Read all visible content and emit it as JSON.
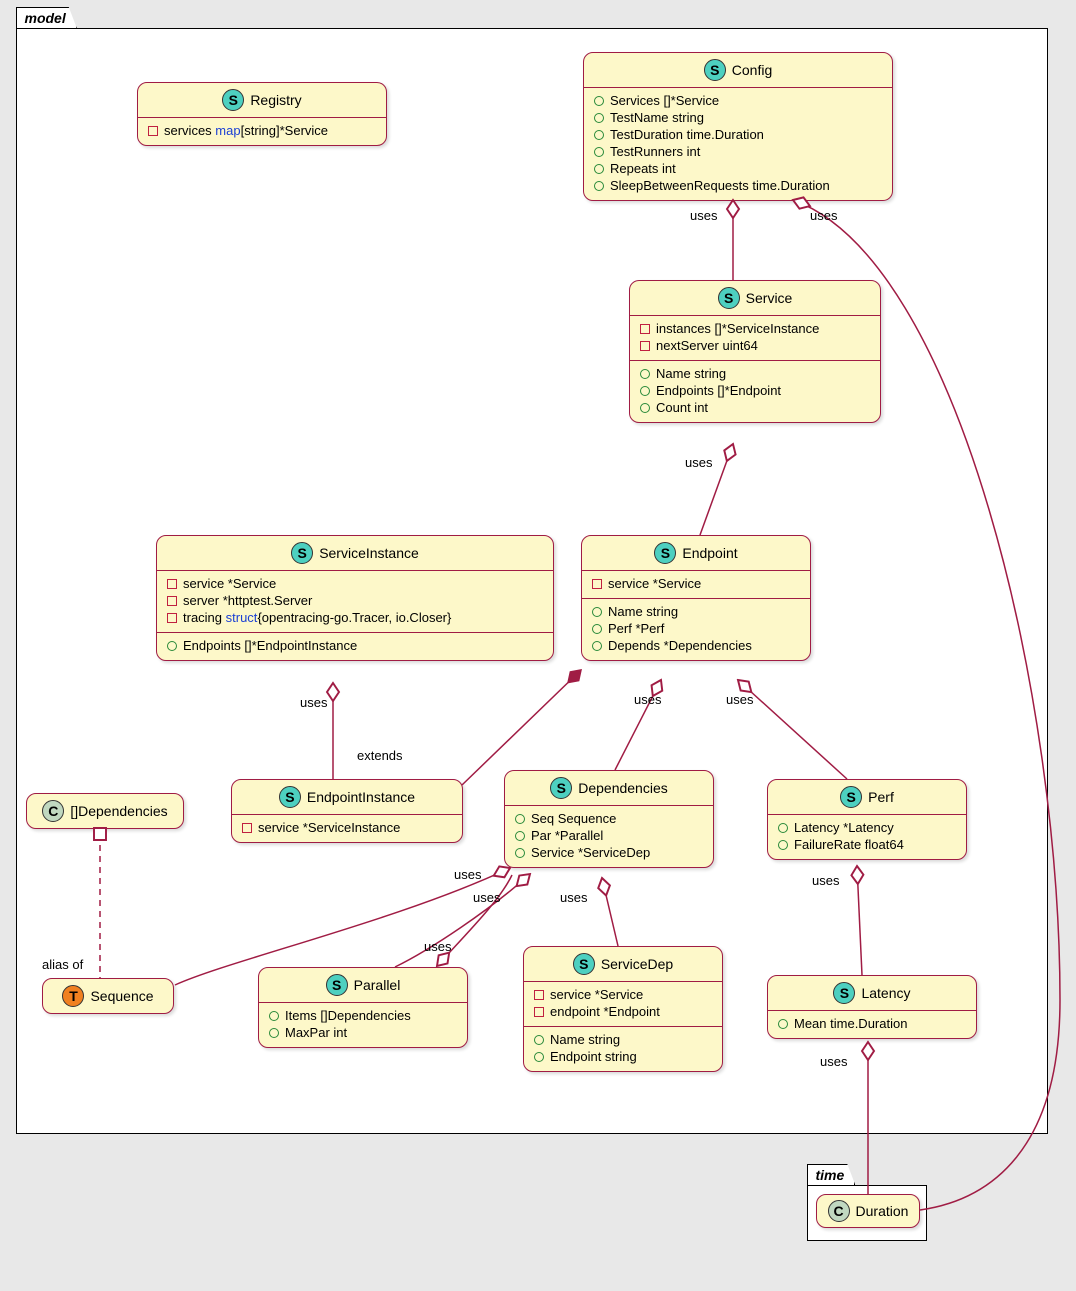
{
  "packages": {
    "model": "model",
    "time": "time"
  },
  "classes": {
    "Registry": {
      "name": "Registry",
      "icon": "S",
      "attrs": [
        {
          "vis": "priv",
          "text": "services ",
          "kw": "map",
          "rest": "[string]*Service"
        }
      ]
    },
    "Config": {
      "name": "Config",
      "icon": "S",
      "attrs": [
        {
          "vis": "pub",
          "text": "Services []*Service"
        },
        {
          "vis": "pub",
          "text": "TestName string"
        },
        {
          "vis": "pub",
          "text": "TestDuration time.Duration"
        },
        {
          "vis": "pub",
          "text": "TestRunners int"
        },
        {
          "vis": "pub",
          "text": "Repeats int"
        },
        {
          "vis": "pub",
          "text": "SleepBetweenRequests time.Duration"
        }
      ]
    },
    "Service": {
      "name": "Service",
      "icon": "S",
      "sectionA": [
        {
          "vis": "priv",
          "text": "instances []*ServiceInstance"
        },
        {
          "vis": "priv",
          "text": "nextServer uint64"
        }
      ],
      "sectionB": [
        {
          "vis": "pub",
          "text": "Name string"
        },
        {
          "vis": "pub",
          "text": "Endpoints []*Endpoint"
        },
        {
          "vis": "pub",
          "text": "Count int"
        }
      ]
    },
    "ServiceInstance": {
      "name": "ServiceInstance",
      "icon": "S",
      "sectionA": [
        {
          "vis": "priv",
          "text": "service *Service"
        },
        {
          "vis": "priv",
          "text": "server *httptest.Server"
        },
        {
          "vis": "priv",
          "text": "tracing ",
          "kw": "struct",
          "rest": "{opentracing-go.Tracer, io.Closer}"
        }
      ],
      "sectionB": [
        {
          "vis": "pub",
          "text": "Endpoints []*EndpointInstance"
        }
      ]
    },
    "Endpoint": {
      "name": "Endpoint",
      "icon": "S",
      "sectionA": [
        {
          "vis": "priv",
          "text": "service *Service"
        }
      ],
      "sectionB": [
        {
          "vis": "pub",
          "text": "Name string"
        },
        {
          "vis": "pub",
          "text": "Perf *Perf"
        },
        {
          "vis": "pub",
          "text": "Depends *Dependencies"
        }
      ]
    },
    "DependenciesC": {
      "name": "[]Dependencies",
      "icon": "C"
    },
    "EndpointInstance": {
      "name": "EndpointInstance",
      "icon": "S",
      "attrs": [
        {
          "vis": "priv",
          "text": "service *ServiceInstance"
        }
      ]
    },
    "Dependencies": {
      "name": "Dependencies",
      "icon": "S",
      "attrs": [
        {
          "vis": "pub",
          "text": "Seq Sequence"
        },
        {
          "vis": "pub",
          "text": "Par *Parallel"
        },
        {
          "vis": "pub",
          "text": "Service *ServiceDep"
        }
      ]
    },
    "Perf": {
      "name": "Perf",
      "icon": "S",
      "attrs": [
        {
          "vis": "pub",
          "text": "Latency *Latency"
        },
        {
          "vis": "pub",
          "text": "FailureRate float64"
        }
      ]
    },
    "Sequence": {
      "name": "Sequence",
      "icon": "T"
    },
    "Parallel": {
      "name": "Parallel",
      "icon": "S",
      "attrs": [
        {
          "vis": "pub",
          "text": "Items []Dependencies"
        },
        {
          "vis": "pub",
          "text": "MaxPar int"
        }
      ]
    },
    "ServiceDep": {
      "name": "ServiceDep",
      "icon": "S",
      "sectionA": [
        {
          "vis": "priv",
          "text": "service *Service"
        },
        {
          "vis": "priv",
          "text": "endpoint *Endpoint"
        }
      ],
      "sectionB": [
        {
          "vis": "pub",
          "text": "Name string"
        },
        {
          "vis": "pub",
          "text": "Endpoint string"
        }
      ]
    },
    "Latency": {
      "name": "Latency",
      "icon": "S",
      "attrs": [
        {
          "vis": "pub",
          "text": "Mean time.Duration"
        }
      ]
    },
    "Duration": {
      "name": "Duration",
      "icon": "C"
    }
  },
  "edgeLabels": {
    "uses1": "uses",
    "uses2": "uses",
    "uses3": "uses",
    "uses4": "uses",
    "uses5": "uses",
    "uses6": "uses",
    "uses7": "uses",
    "uses8": "uses",
    "uses9": "uses",
    "uses10": "uses",
    "uses11": "uses",
    "extends": "extends",
    "aliasof": "alias of"
  }
}
